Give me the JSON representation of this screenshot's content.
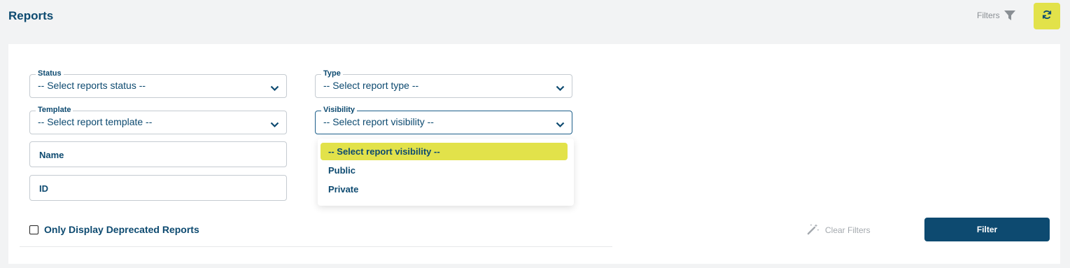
{
  "header": {
    "title": "Reports",
    "filters_label": "Filters",
    "filter_icon": "funnel-icon",
    "refresh_icon": "refresh-icon"
  },
  "colors": {
    "accent": "#e2e24a",
    "primary": "#0d4a70",
    "background": "#f2f3f4"
  },
  "fields": {
    "status": {
      "label": "Status",
      "value": "-- Select reports status --"
    },
    "type": {
      "label": "Type",
      "value": "-- Select report type --"
    },
    "template": {
      "label": "Template",
      "value": "-- Select report template --"
    },
    "visibility": {
      "label": "Visibility",
      "value": "-- Select report visibility --"
    },
    "name": {
      "placeholder": "Name"
    },
    "id": {
      "placeholder": "ID"
    }
  },
  "visibility_dropdown": {
    "options": [
      {
        "label": "-- Select report visibility --",
        "selected": true
      },
      {
        "label": "Public",
        "selected": false
      },
      {
        "label": "Private",
        "selected": false
      }
    ]
  },
  "deprecated_checkbox": {
    "label": "Only Display Deprecated Reports",
    "checked": false
  },
  "actions": {
    "clear_filters_label": "Clear Filters",
    "filter_label": "Filter"
  }
}
